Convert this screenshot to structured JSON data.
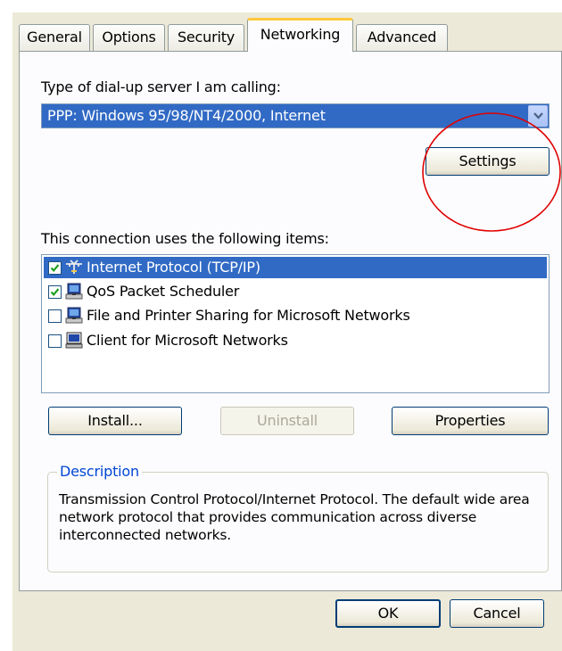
{
  "tabs": [
    {
      "label": "General",
      "active": false
    },
    {
      "label": "Options",
      "active": false
    },
    {
      "label": "Security",
      "active": false
    },
    {
      "label": "Networking",
      "active": true
    },
    {
      "label": "Advanced",
      "active": false
    }
  ],
  "server_type": {
    "label": "Type of dial-up server I am calling:",
    "selected": "PPP: Windows 95/98/NT4/2000, Internet"
  },
  "settings_button": "Settings",
  "items": {
    "label": "This connection uses the following items:",
    "list": [
      {
        "label": "Internet Protocol (TCP/IP)",
        "checked": true,
        "selected": true,
        "icon": "network-protocol-icon"
      },
      {
        "label": "QoS Packet Scheduler",
        "checked": true,
        "selected": false,
        "icon": "network-service-icon"
      },
      {
        "label": "File and Printer Sharing for Microsoft Networks",
        "checked": false,
        "selected": false,
        "icon": "network-service-icon"
      },
      {
        "label": "Client for Microsoft Networks",
        "checked": false,
        "selected": false,
        "icon": "network-client-icon"
      }
    ]
  },
  "buttons": {
    "install": "Install...",
    "uninstall": "Uninstall",
    "properties": "Properties",
    "ok": "OK",
    "cancel": "Cancel"
  },
  "description": {
    "legend": "Description",
    "text": "Transmission Control Protocol/Internet Protocol. The default wide area network protocol that provides communication across diverse interconnected networks."
  },
  "colors": {
    "selection": "#316ac5",
    "active_tab_accent": "#ffc83c",
    "annotation": "#e00000",
    "legend_text": "#0046d5"
  }
}
